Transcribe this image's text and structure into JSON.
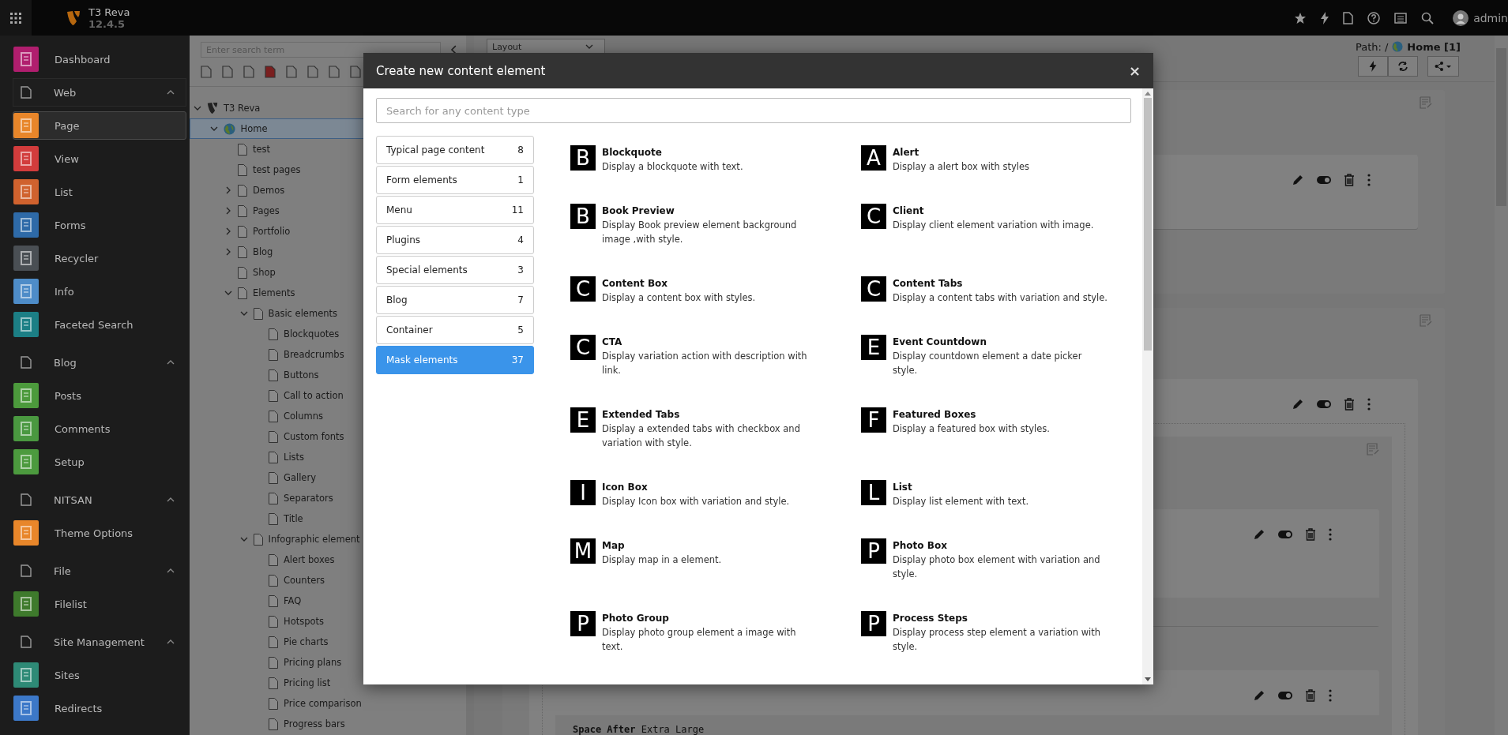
{
  "header": {
    "site_name": "T3 Reva",
    "version": "12.4.5",
    "user": "admin"
  },
  "sidebar": {
    "items": [
      {
        "kind": "module",
        "label": "Dashboard",
        "color": "#b01e6e",
        "selected": false
      },
      {
        "kind": "group",
        "label": "Web",
        "expanded": true
      },
      {
        "kind": "module",
        "label": "Page",
        "color": "#e8862a",
        "selected": true
      },
      {
        "kind": "module",
        "label": "View",
        "color": "#d23c3c",
        "selected": false
      },
      {
        "kind": "module",
        "label": "List",
        "color": "#d0622e",
        "selected": false
      },
      {
        "kind": "module",
        "label": "Forms",
        "color": "#2e6aa8",
        "selected": false
      },
      {
        "kind": "module",
        "label": "Recycler",
        "color": "#4a4f54",
        "selected": false
      },
      {
        "kind": "module",
        "label": "Info",
        "color": "#4e8cc8",
        "selected": false
      },
      {
        "kind": "module",
        "label": "Faceted Search",
        "color": "#1c7f85",
        "selected": false
      },
      {
        "kind": "group",
        "label": "Blog",
        "expanded": true
      },
      {
        "kind": "module",
        "label": "Posts",
        "color": "#4c9a3c",
        "selected": false
      },
      {
        "kind": "module",
        "label": "Comments",
        "color": "#4a9840",
        "selected": false
      },
      {
        "kind": "module",
        "label": "Setup",
        "color": "#4c9a3e",
        "selected": false
      },
      {
        "kind": "group",
        "label": "NITSAN",
        "expanded": true
      },
      {
        "kind": "module",
        "label": "Theme Options",
        "color": "#e8862a",
        "selected": false
      },
      {
        "kind": "group",
        "label": "File",
        "expanded": true
      },
      {
        "kind": "module",
        "label": "Filelist",
        "color": "#3e7a2c",
        "selected": false
      },
      {
        "kind": "group",
        "label": "Site Management",
        "expanded": true
      },
      {
        "kind": "module",
        "label": "Sites",
        "color": "#2e8a76",
        "selected": false
      },
      {
        "kind": "module",
        "label": "Redirects",
        "color": "#3c78c8",
        "selected": false
      }
    ]
  },
  "page_tree": {
    "search": {
      "placeholder": "Enter search term"
    },
    "nodes": [
      {
        "kind": "site",
        "label": "T3 Reva",
        "expanded": true,
        "selected": false,
        "children": [
          {
            "kind": "home",
            "label": "Home",
            "expanded": true,
            "selected": true,
            "children": [
              {
                "kind": "page",
                "label": "test",
                "selected": false
              },
              {
                "kind": "page",
                "label": "test pages",
                "selected": false
              },
              {
                "kind": "page",
                "label": "Demos",
                "expanded": false,
                "selected": false
              },
              {
                "kind": "page",
                "label": "Pages",
                "expanded": false,
                "selected": false
              },
              {
                "kind": "page",
                "label": "Portfolio",
                "expanded": false,
                "selected": false
              },
              {
                "kind": "page",
                "label": "Blog",
                "expanded": false,
                "selected": false
              },
              {
                "kind": "page",
                "label": "Shop",
                "selected": false
              },
              {
                "kind": "page",
                "label": "Elements",
                "expanded": true,
                "selected": false,
                "children": [
                  {
                    "kind": "page",
                    "label": "Basic elements",
                    "expanded": true,
                    "selected": false,
                    "children": [
                      {
                        "kind": "page",
                        "label": "Blockquotes",
                        "selected": false
                      },
                      {
                        "kind": "page",
                        "label": "Breadcrumbs",
                        "selected": false
                      },
                      {
                        "kind": "page",
                        "label": "Buttons",
                        "selected": false
                      },
                      {
                        "kind": "page",
                        "label": "Call to action",
                        "selected": false
                      },
                      {
                        "kind": "page",
                        "label": "Columns",
                        "selected": false
                      },
                      {
                        "kind": "page",
                        "label": "Custom fonts",
                        "selected": false
                      },
                      {
                        "kind": "page",
                        "label": "Lists",
                        "selected": false
                      },
                      {
                        "kind": "page",
                        "label": "Gallery",
                        "selected": false
                      },
                      {
                        "kind": "page",
                        "label": "Separators",
                        "selected": false
                      },
                      {
                        "kind": "page",
                        "label": "Title",
                        "selected": false
                      }
                    ]
                  },
                  {
                    "kind": "page",
                    "label": "Infographic element",
                    "expanded": true,
                    "selected": false,
                    "children": [
                      {
                        "kind": "page",
                        "label": "Alert boxes",
                        "selected": false
                      },
                      {
                        "kind": "page",
                        "label": "Counters",
                        "selected": false
                      },
                      {
                        "kind": "page",
                        "label": "FAQ",
                        "selected": false
                      },
                      {
                        "kind": "page",
                        "label": "Hotspots",
                        "selected": false
                      },
                      {
                        "kind": "page",
                        "label": "Pie charts",
                        "selected": false
                      },
                      {
                        "kind": "page",
                        "label": "Pricing plans",
                        "selected": false
                      },
                      {
                        "kind": "page",
                        "label": "Pricing list",
                        "selected": false
                      },
                      {
                        "kind": "page",
                        "label": "Price comparison",
                        "selected": false
                      },
                      {
                        "kind": "page",
                        "label": "Progress bars",
                        "selected": false
                      }
                    ]
                  }
                ]
              }
            ]
          }
        ]
      }
    ]
  },
  "content": {
    "layout_select": "Layout",
    "path_label": "Path: /",
    "path_page": "Home [1]",
    "space_after": "**Space After** Extra Large"
  },
  "modal": {
    "title": "Create new content element",
    "close": "×",
    "search": {
      "placeholder": "Search for any content type"
    },
    "categories": [
      {
        "label": "Typical page content",
        "count": "8",
        "selected": false
      },
      {
        "label": "Form elements",
        "count": "1",
        "selected": false
      },
      {
        "label": "Menu",
        "count": "11",
        "selected": false
      },
      {
        "label": "Plugins",
        "count": "4",
        "selected": false
      },
      {
        "label": "Special elements",
        "count": "3",
        "selected": false
      },
      {
        "label": "Blog",
        "count": "7",
        "selected": false
      },
      {
        "label": "Container",
        "count": "5",
        "selected": false
      },
      {
        "label": "Mask elements",
        "count": "37",
        "selected": true
      }
    ],
    "elements": [
      {
        "letter": "B",
        "title": "Blockquote",
        "description": "Display a blockquote with text."
      },
      {
        "letter": "A",
        "title": "Alert",
        "description": "Display a alert box with styles"
      },
      {
        "letter": "B",
        "title": "Book Preview",
        "description": "Display Book preview element background image ,with style."
      },
      {
        "letter": "C",
        "title": "Client",
        "description": "Display client element variation with image."
      },
      {
        "letter": "C",
        "title": "Content Box",
        "description": "Display a content box with styles."
      },
      {
        "letter": "C",
        "title": "Content Tabs",
        "description": "Display a content tabs with variation and style."
      },
      {
        "letter": "C",
        "title": "CTA",
        "description": "Display variation action with description with link."
      },
      {
        "letter": "E",
        "title": "Event Countdown",
        "description": "Display countdown element a date picker style."
      },
      {
        "letter": "E",
        "title": "Extended Tabs",
        "description": "Display a extended tabs with checkbox and variation with style."
      },
      {
        "letter": "F",
        "title": "Featured Boxes",
        "description": "Display a featured box with styles."
      },
      {
        "letter": "I",
        "title": "Icon Box",
        "description": "Display Icon box with variation and style."
      },
      {
        "letter": "L",
        "title": "List",
        "description": "Display list element with text."
      },
      {
        "letter": "M",
        "title": "Map",
        "description": "Display map in a element."
      },
      {
        "letter": "P",
        "title": "Photo Box",
        "description": "Display photo box element with variation and style."
      },
      {
        "letter": "P",
        "title": "Photo Group",
        "description": "Display photo group element a image with text."
      },
      {
        "letter": "P",
        "title": "Process Steps",
        "description": "Display process step element a variation with style."
      }
    ]
  }
}
